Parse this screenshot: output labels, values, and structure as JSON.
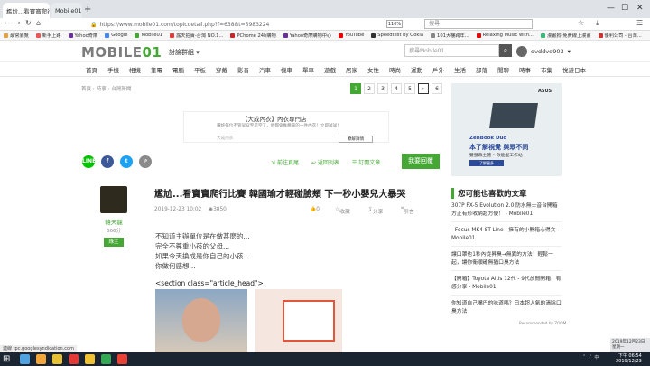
{
  "browser": {
    "tabs": [
      {
        "label": "尷尬...看寶寶爬行比賽 韓國瑜才輕...",
        "active": true
      },
      {
        "label": "Mobile01",
        "active": false
      }
    ],
    "new_tab": "+",
    "url": "https://www.mobile01.com/topicdetail.php?f=638&t=5983224",
    "zoom": "110%",
    "search_placeholder": "搜尋"
  },
  "bookmarks": [
    {
      "label": "最常瀏覽",
      "color": "#e6a23c"
    },
    {
      "label": "新手上路",
      "color": "#e55"
    },
    {
      "label": "Yahoo奇摩",
      "color": "#6b2fa0"
    },
    {
      "label": "Google",
      "color": "#4285f4"
    },
    {
      "label": "Mobile01",
      "color": "#45a835"
    },
    {
      "label": "露天拍賣-台灣 NO.1...",
      "color": "#e53935"
    },
    {
      "label": "PChome 24h購物",
      "color": "#c62828"
    },
    {
      "label": "Yahoo奇摩購物中心",
      "color": "#6b2fa0"
    },
    {
      "label": "YouTube",
      "color": "#e00"
    },
    {
      "label": "Speedtest by Ookla",
      "color": "#333"
    },
    {
      "label": "101大樓跨年...",
      "color": "#888"
    },
    {
      "label": "Relaxing Music with...",
      "color": "#e00"
    },
    {
      "label": "漫畫狗-免費線上漫畫",
      "color": "#3b7"
    },
    {
      "label": "優利公司 - 台灣...",
      "color": "#c33"
    }
  ],
  "site": {
    "logo_main": "MOBILE",
    "logo_num": "01",
    "forum_label": "討論群組 ▾",
    "search_placeholder": "搜尋Mobile01",
    "username": "dvddvd903"
  },
  "categories": [
    "首頁",
    "手機",
    "相機",
    "筆電",
    "電腦",
    "平板",
    "穿戴",
    "影音",
    "汽車",
    "機車",
    "單車",
    "遊戲",
    "居家",
    "女性",
    "時尚",
    "運動",
    "戶外",
    "生活",
    "部落",
    "閒聊",
    "時事",
    "市集",
    "悅遊日本"
  ],
  "breadcrumb": "首頁 › 時事 › 台灣新聞",
  "pager": [
    "1",
    "2",
    "3",
    "4",
    "5",
    "›",
    "6"
  ],
  "ad": {
    "title": "【大成內衣】內衣專門店",
    "text": "讓妳每位不管早穿至是空了，他都會推薦來的一件內衣！立即試試！",
    "source": "大成內衣",
    "button": "瞭解詳情"
  },
  "social": [
    {
      "label": "LINE",
      "color": "#00c300"
    },
    {
      "label": "f",
      "color": "#3b5998"
    },
    {
      "label": "t",
      "color": "#1da1f2"
    },
    {
      "label": "⇗",
      "color": "#8a8a8a"
    }
  ],
  "actions": [
    "前往頁尾",
    "返回列表",
    "訂閱文章"
  ],
  "reply_button": "我要回覆",
  "author": {
    "name": "韓天龍",
    "points": "666分",
    "badge": "綠主"
  },
  "article": {
    "title": "尷尬...看寶寶爬行比賽 韓國瑜才輕碰臉頰 下一秒小嬰兒大暴哭",
    "date": "2019-12-23 10:02",
    "views": "3850",
    "likes": "0",
    "bookmark": "收藏",
    "share": "分享",
    "quote": "引言",
    "body": [
      "不知道主辦單位是在做甚麼的...",
      "完全不尊重小孩的父母...",
      "如果今天換成是你自己的小孩...",
      "你做何感想..."
    ],
    "section_tag": "<section class=\"article_head\">"
  },
  "sidebar": {
    "ad_brand": "ASUS",
    "ad_line1": "ZenBook Duo",
    "ad_line2": "本了解視覺 與眾不同",
    "ad_line3": "雙螢幕主體 • 效能型工作站",
    "ad_btn": "了解更多",
    "related_title": "您可能也喜歡的文章",
    "related": [
      "307P PX-5 Evolution 2.0 防水無士音台開箱 方正有形收納超方便！ - Mobile01",
      "- Focus MK4 ST-Line - 擁有的小開箱心得文 - Mobile01",
      "讓口罩也1秒內從昇臭→無異的方法！輕鬆一起，讓你衛順確無猶口臭方法",
      "【開箱】Toyota Altis 12代 - 9代放閒開箱，有感分享 - Mobile01",
      "你知道自己嘴巴的味道嗎？日本超人氣的清除口臭方法"
    ],
    "recommended": "Recommended by ZOOM"
  },
  "status_url": "連線 tpc.googlesyndication.com",
  "taskbar": {
    "apps": [
      "#4fa3e0",
      "#f3a63b",
      "#e8c233",
      "#e53935",
      "#f1c232",
      "#34a853",
      "#ea4335"
    ],
    "time": "下午 06:54",
    "date": "2019/12/23",
    "notif_date": "2019年12月23日",
    "notif_day": "星期一"
  }
}
